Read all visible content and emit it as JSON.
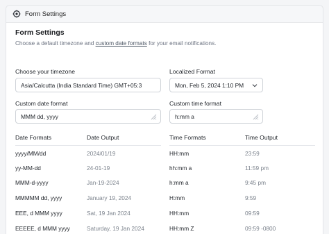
{
  "titlebar": {
    "title": "Form Settings",
    "icon": "gear-icon"
  },
  "header": {
    "title": "Form Settings",
    "desc_before": "Choose a default timezone and ",
    "desc_link": "custom date formats",
    "desc_after": " for your email notifications."
  },
  "timezone": {
    "label": "Choose your timezone",
    "value": "Asia/Calcutta (India Standard Time) GMT+05:3"
  },
  "localized": {
    "label": "Localized Format",
    "value": "Mon, Feb 5, 2024 1:10 PM"
  },
  "custom_date": {
    "label": "Custom date format",
    "value": "MMM dd, yyyy"
  },
  "custom_time": {
    "label": "Custom time format",
    "value": "h:mm a"
  },
  "date_table": {
    "headers": [
      "Date Formats",
      "Date Output"
    ],
    "rows": [
      [
        "yyyy/MM/dd",
        "2024/01/19"
      ],
      [
        "yy-MM-dd",
        "24-01-19"
      ],
      [
        "MMM-d-yyyy",
        "Jan-19-2024"
      ],
      [
        "MMMMM dd, yyyy",
        "January 19, 2024"
      ],
      [
        "EEE, d MMM yyyy",
        "Sat, 19 Jan 2024"
      ],
      [
        "EEEEE, d MMM yyyy",
        "Saturday, 19 Jan 2024"
      ]
    ]
  },
  "time_table": {
    "headers": [
      "Time Formats",
      "Time Output"
    ],
    "rows": [
      [
        "HH:mm",
        "23:59"
      ],
      [
        "hh:mm a",
        "11:59 pm"
      ],
      [
        "h:mm a",
        "9:45 pm"
      ],
      [
        "H:mm",
        "9:59"
      ],
      [
        "HH:mm",
        "09:59"
      ],
      [
        "HH:mm Z",
        "09:59 -0800"
      ]
    ]
  },
  "colors": {
    "muted_text": "#7b828c",
    "border": "#cfd3d8",
    "divider": "#e5e7eb"
  }
}
